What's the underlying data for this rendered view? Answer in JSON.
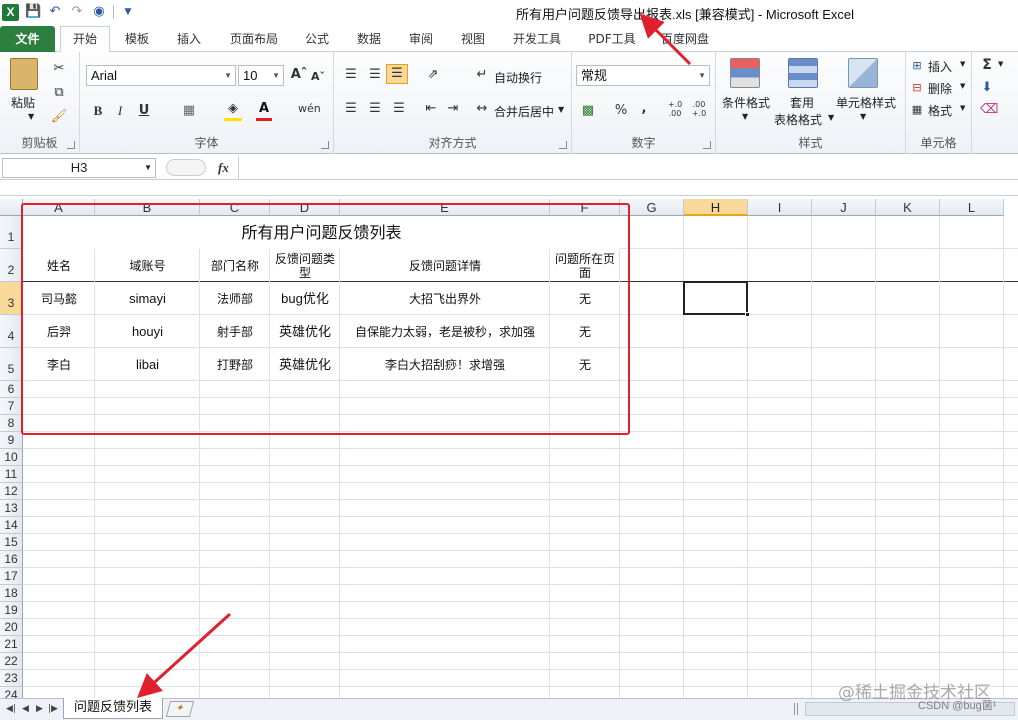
{
  "app": {
    "window_title": "所有用户问题反馈导出报表.xls  [兼容模式]  -  Microsoft Excel",
    "logo_letter": "X"
  },
  "tabs": [
    "文件",
    "开始",
    "模板",
    "插入",
    "页面布局",
    "公式",
    "数据",
    "审阅",
    "视图",
    "开发工具",
    "PDF工具",
    "百度网盘"
  ],
  "ribbon": {
    "clipboard": {
      "label": "剪贴板",
      "paste": "粘贴"
    },
    "font": {
      "label": "字体",
      "font_name": "Arial",
      "font_size": "10",
      "bold": "B",
      "italic": "I",
      "underline": "U"
    },
    "alignment": {
      "label": "对齐方式",
      "wrap_text": "自动换行",
      "merge_center": "合并后居中"
    },
    "number": {
      "label": "数字",
      "format": "常规",
      "percent": "%",
      "comma": ",",
      "inc_decimal": "+.0\n.00",
      "dec_decimal": ".00\n+.0"
    },
    "styles": {
      "label": "样式",
      "conditional": "条件格式",
      "table_format_1": "套用",
      "table_format_2": "表格格式",
      "cell_styles": "单元格样式"
    },
    "cells": {
      "label": "单元格",
      "insert": "插入",
      "delete": "删除",
      "format": "格式"
    },
    "editing": {
      "sum": "Σ"
    }
  },
  "formula_bar": {
    "name_box": "H3",
    "fx": "fx",
    "content": ""
  },
  "columns": [
    "A",
    "B",
    "C",
    "D",
    "E",
    "F",
    "G",
    "H",
    "I",
    "J",
    "K",
    "L"
  ],
  "rows": [
    "1",
    "2",
    "3",
    "4",
    "5",
    "6",
    "7",
    "8",
    "9",
    "10",
    "11",
    "12",
    "13",
    "14",
    "15",
    "16",
    "17",
    "18",
    "19",
    "20",
    "21",
    "22",
    "23",
    "24"
  ],
  "sheet": {
    "title": "所有用户问题反馈列表",
    "headers": [
      "姓名",
      "域账号",
      "部门名称",
      "反馈问题类型",
      "反馈问题详情",
      "问题所在页面"
    ],
    "data": [
      [
        "司马懿",
        "simayi",
        "法师部",
        "bug优化",
        "大招飞出界外",
        "无"
      ],
      [
        "后羿",
        "houyi",
        "射手部",
        "英雄优化",
        "自保能力太弱，老是被秒，求加强",
        "无"
      ],
      [
        "李白",
        "libai",
        "打野部",
        "英雄优化",
        "李白大招刮痧！求增强",
        "无"
      ]
    ]
  },
  "sheet_tabs": {
    "active": "问题反馈列表"
  },
  "watermarks": {
    "line1": "@稀土掘金技术社区",
    "line2": "CSDN @bug菌¹"
  },
  "colors": {
    "accent_green": "#2c7f3e",
    "annotation_red": "#e0202a",
    "selected_header": "#f9d99a"
  }
}
